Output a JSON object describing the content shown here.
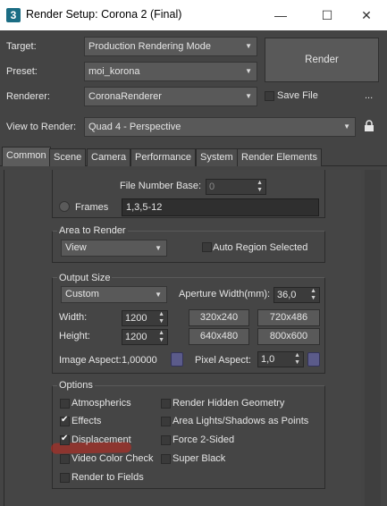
{
  "window": {
    "icon_glyph": "3",
    "title": "Render Setup: Corona 2 (Final)",
    "minimize": "—",
    "maximize": "☐",
    "close": "✕"
  },
  "top": {
    "target_label": "Target:",
    "target_value": "Production Rendering Mode",
    "preset_label": "Preset:",
    "preset_value": "moi_korona",
    "renderer_label": "Renderer:",
    "renderer_value": "CoronaRenderer",
    "save_file_label": "Save File",
    "more_label": "...",
    "view_label": "View to Render:",
    "view_value": "Quad 4 - Perspective",
    "render_button": "Render"
  },
  "tabs": [
    {
      "label": "Common",
      "active": true
    },
    {
      "label": "Scene",
      "active": false
    },
    {
      "label": "Camera",
      "active": false
    },
    {
      "label": "Performance",
      "active": false
    },
    {
      "label": "System",
      "active": false
    },
    {
      "label": "Render Elements",
      "active": false
    }
  ],
  "frames": {
    "file_number_base_label": "File Number Base:",
    "file_number_base_value": "0",
    "frames_label": "Frames",
    "frames_value": "1,3,5-12"
  },
  "area": {
    "title": "Area to Render",
    "value": "View",
    "auto_region_label": "Auto Region Selected"
  },
  "output": {
    "title": "Output Size",
    "preset_value": "Custom",
    "aperture_label": "Aperture Width(mm):",
    "aperture_value": "36,0",
    "width_label": "Width:",
    "width_value": "1200",
    "height_label": "Height:",
    "height_value": "1200",
    "presets": [
      "320x240",
      "720x486",
      "640x480",
      "800x600"
    ],
    "image_aspect_label": "Image Aspect:",
    "image_aspect_value": "1,00000",
    "pixel_aspect_label": "Pixel Aspect:",
    "pixel_aspect_value": "1,0"
  },
  "options": {
    "title": "Options",
    "items": [
      {
        "label": "Atmospherics",
        "checked": false
      },
      {
        "label": "Render Hidden Geometry",
        "checked": false
      },
      {
        "label": "Effects",
        "checked": true
      },
      {
        "label": "Area Lights/Shadows as Points",
        "checked": false
      },
      {
        "label": "Displacement",
        "checked": true
      },
      {
        "label": "Force 2-Sided",
        "checked": false
      },
      {
        "label": "Video Color Check",
        "checked": false
      },
      {
        "label": "Super Black",
        "checked": false
      },
      {
        "label": "Render to Fields",
        "checked": false
      }
    ]
  },
  "colors": {
    "background": "#444444",
    "titlebar": "#ffffff",
    "accent_lock": "#5b5b8a",
    "annotation_highlight": "#c8281e"
  }
}
